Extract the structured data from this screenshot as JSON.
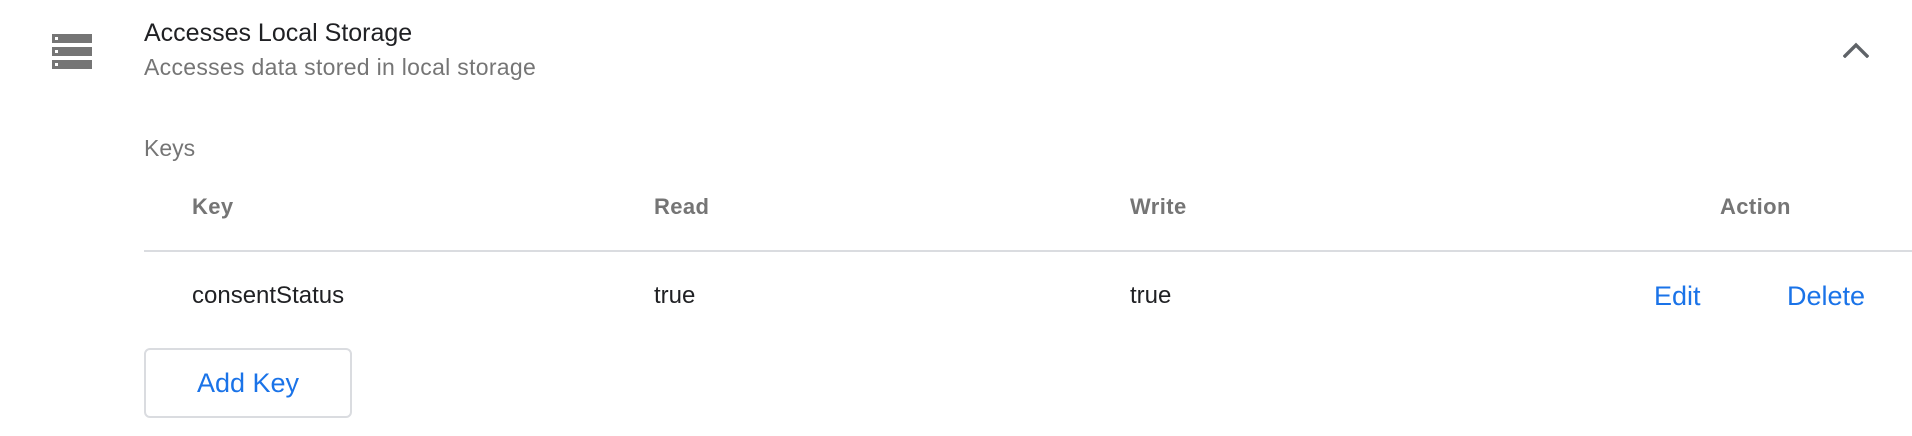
{
  "section": {
    "icon": "storage-icon",
    "title": "Accesses Local Storage",
    "subtitle": "Accesses data stored in local storage",
    "collapse_icon": "chevron-up-icon"
  },
  "keys": {
    "label": "Keys",
    "columns": {
      "key": "Key",
      "read": "Read",
      "write": "Write",
      "action": "Action"
    },
    "rows": [
      {
        "key": "consentStatus",
        "read": "true",
        "write": "true",
        "edit_label": "Edit",
        "delete_label": "Delete"
      }
    ],
    "add_button_label": "Add Key"
  },
  "colors": {
    "accent": "#1a73e8",
    "secondary_text": "#757575",
    "icon": "#757575",
    "divider": "#dadce0"
  }
}
